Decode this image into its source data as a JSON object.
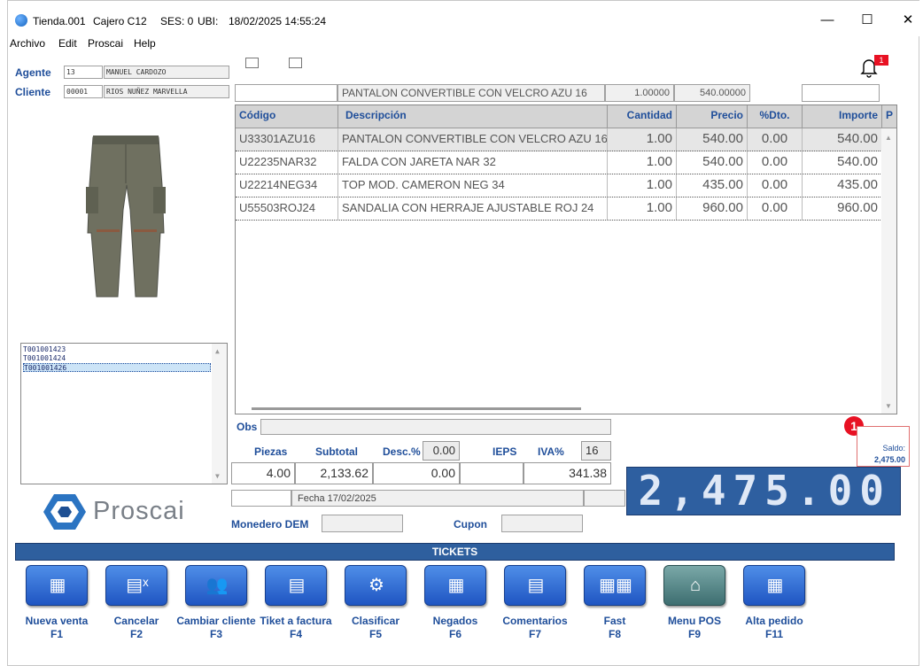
{
  "titlebar": {
    "store": "Tienda.001",
    "cashier": "Cajero C12",
    "session": "SES: 0",
    "ubi": "UBI:",
    "datetime": "18/02/2025 14:55:24",
    "minimize": "—",
    "maximize": "☐",
    "close": "✕"
  },
  "menu": [
    "Archivo",
    "Edit",
    "Proscai",
    "Help"
  ],
  "header": {
    "agent_label": "Agente",
    "agent_code": "13",
    "agent_name": "MANUEL CARDOZO",
    "client_label": "Cliente",
    "client_code": "00001",
    "client_name": "RIOS NUÑEZ MARVELLA",
    "notification_count": "1"
  },
  "entry": {
    "code": "",
    "description": "PANTALON CONVERTIBLE CON VELCRO AZU 16",
    "quantity": "1.00000",
    "price": "540.00000",
    "extra": ""
  },
  "grid": {
    "columns": [
      "Código",
      "Descripción",
      "Cantidad",
      "Precio",
      "%Dto.",
      "Importe",
      "P"
    ],
    "rows": [
      {
        "code": "U33301AZU16",
        "desc": "PANTALON CONVERTIBLE CON VELCRO AZU 16",
        "qty": "1.00",
        "price": "540.00",
        "disc": "0.00",
        "amount": "540.00"
      },
      {
        "code": "U22235NAR32",
        "desc": "FALDA CON JARETA NAR 32",
        "qty": "1.00",
        "price": "540.00",
        "disc": "0.00",
        "amount": "540.00"
      },
      {
        "code": "U22214NEG34",
        "desc": "TOP MOD. CAMERON NEG 34",
        "qty": "1.00",
        "price": "435.00",
        "disc": "0.00",
        "amount": "435.00"
      },
      {
        "code": "U55503ROJ24",
        "desc": "SANDALIA CON HERRAJE AJUSTABLE ROJ 24",
        "qty": "1.00",
        "price": "960.00",
        "disc": "0.00",
        "amount": "960.00"
      }
    ]
  },
  "tickets_list": [
    "T001001423",
    "T001001424",
    "T001001426"
  ],
  "tickets_selected_index": 2,
  "brand": "Proscai",
  "totals": {
    "obs_label": "Obs",
    "pieces_label": "Piezas",
    "subtotal_label": "Subtotal",
    "disc_label": "Desc.%",
    "disc_pct": "0.00",
    "ieps_label": "IEPS",
    "iva_label": "IVA%",
    "iva_pct": "16",
    "pieces": "4.00",
    "subtotal": "2,133.62",
    "discount": "0.00",
    "ieps": "",
    "iva": "341.38",
    "date_text": "Fecha 17/02/2025",
    "wallet_label": "Monedero DEM",
    "coupon_label": "Cupon",
    "grand_total": "2,475.00",
    "balance_badge": "1",
    "balance_label": "Saldo:",
    "balance_value": "2,475.00"
  },
  "ticket_bar": "TICKETS",
  "buttons": [
    {
      "label": "Nueva venta",
      "key": "F1",
      "icon": "new-sale-icon"
    },
    {
      "label": "Cancelar",
      "key": "F2",
      "icon": "cancel-icon"
    },
    {
      "label": "Cambiar cliente",
      "key": "F3",
      "icon": "users-icon"
    },
    {
      "label": "Tiket a factura",
      "key": "F4",
      "icon": "invoice-icon"
    },
    {
      "label": "Clasificar",
      "key": "F5",
      "icon": "classify-icon"
    },
    {
      "label": "Negados",
      "key": "F6",
      "icon": "grid-icon"
    },
    {
      "label": "Comentarios",
      "key": "F7",
      "icon": "comments-icon"
    },
    {
      "label": "Fast",
      "key": "F8",
      "icon": "fast-icon"
    },
    {
      "label": "Menu POS",
      "key": "F9",
      "icon": "home-icon"
    },
    {
      "label": "Alta pedido",
      "key": "F11",
      "icon": "new-order-icon"
    }
  ],
  "colors": {
    "accent": "#1f4e9a",
    "total_bg": "#2e5fa0",
    "badge": "#e81123"
  }
}
